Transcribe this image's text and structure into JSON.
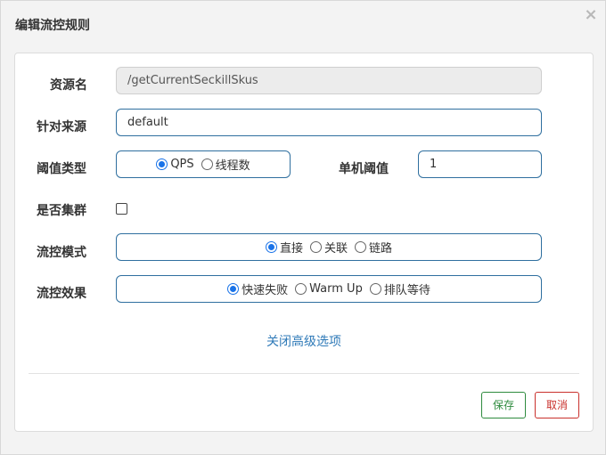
{
  "dialog": {
    "title": "编辑流控规则",
    "close_symbol": "×"
  },
  "form": {
    "resource_name": {
      "label": "资源名",
      "value": "/getCurrentSeckillSkus"
    },
    "limit_app": {
      "label": "针对来源",
      "value": "default"
    },
    "threshold_type": {
      "label": "阈值类型",
      "options": [
        "QPS",
        "线程数"
      ],
      "selected": "QPS"
    },
    "single_threshold": {
      "label": "单机阈值",
      "value": "1"
    },
    "cluster_mode": {
      "label": "是否集群",
      "checked": false
    },
    "control_mode": {
      "label": "流控模式",
      "options": [
        "直接",
        "关联",
        "链路"
      ],
      "selected": "直接"
    },
    "control_effect": {
      "label": "流控效果",
      "options": [
        "快速失败",
        "Warm Up",
        "排队等待"
      ],
      "selected": "快速失败"
    }
  },
  "advanced_link": "关闭高级选项",
  "buttons": {
    "save": "保存",
    "cancel": "取消"
  },
  "colors": {
    "accent": "#1a73e8",
    "field_border": "#2f6f9f",
    "save": "#2e8b3e",
    "cancel": "#c9302c",
    "link": "#2f7ab8"
  }
}
